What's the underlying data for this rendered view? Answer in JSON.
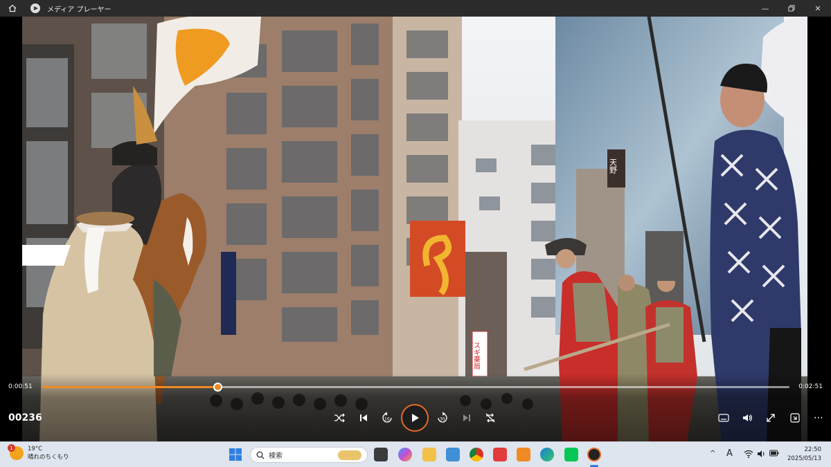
{
  "window": {
    "title": "メディア プレーヤー"
  },
  "player": {
    "current_time": "0:00:51",
    "duration": "0:02:51",
    "progress": 0.235,
    "clip_label": "00236",
    "accent": "#f08a24"
  },
  "video": {
    "shop_sign": "スギ薬局",
    "tower_sign": "天野"
  },
  "taskbar": {
    "weather_temp": "19°C",
    "weather_desc": "晴れのちくもり",
    "weather_badge": "1",
    "search_placeholder": "検索",
    "input_indicator": "A",
    "clock_time": "22:50",
    "clock_date": "2025/05/13",
    "pinned_apps": [
      "windows-start-icon",
      "file-explorer-icon",
      "copilot-icon",
      "folder-icon",
      "photos-icon",
      "chrome-icon",
      "gift-icon",
      "media-icon",
      "edge-icon",
      "line-icon",
      "media-player-icon"
    ]
  }
}
